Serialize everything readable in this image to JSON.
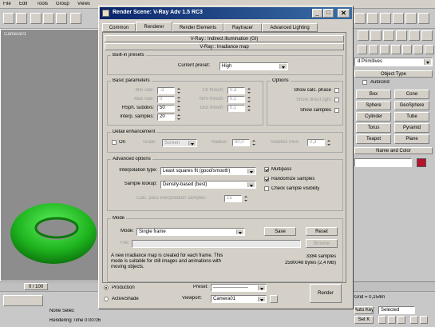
{
  "menubar": {
    "items": [
      "File",
      "Edit",
      "Tools",
      "Group",
      "Views"
    ]
  },
  "viewport": {
    "label": "Camera01"
  },
  "timeline": {
    "frame": "0 / 100"
  },
  "status": {
    "rendering_time": "Rendering Time  0:00:06",
    "none_selected": "None Selec",
    "auto_key": "Auto Key",
    "set_key": "Set K",
    "selected": "Selected",
    "add_time_tag": "Add Time Tag",
    "grid": "Grid = 0,254m"
  },
  "right_panel": {
    "dropdown": "d Primitives",
    "object_type_header": "Object Type",
    "autogrid": "AutoGrid",
    "buttons": [
      "Box",
      "Cone",
      "Sphere",
      "GeoSphere",
      "Cylinder",
      "Tube",
      "Torus",
      "Pyramid",
      "Teapot",
      "Plane"
    ],
    "name_color_header": "Name and Color",
    "color": "#b5122d"
  },
  "dialog": {
    "title": "Render Scene: V-Ray Adv 1.5 RC3",
    "tabs": [
      "Common",
      "Renderer",
      "Render Elements",
      "Raytracer",
      "Advanced Lighting"
    ],
    "rollout_gi": "V-Ray:: Indirect illumination (GI)",
    "rollout_irr": "V-Ray:: Irradiance map",
    "built_in_presets": {
      "title": "Built-in presets",
      "label": "Current preset:",
      "value": "High"
    },
    "basic_params": {
      "title": "Basic parameters",
      "min_rate": {
        "label": "Min rate:",
        "value": "-3"
      },
      "max_rate": {
        "label": "Max rate:",
        "value": "0"
      },
      "hsph": {
        "label": "HSph. subdivs:",
        "value": "50"
      },
      "interp": {
        "label": "Interp. samples:",
        "value": "20"
      },
      "clr_thresh": {
        "label": "Clr thresh:",
        "value": "0,3"
      },
      "nrm_thresh": {
        "label": "Nrm thresh:",
        "value": "0,1"
      },
      "dist_thresh": {
        "label": "Dist thresh:",
        "value": "0,1"
      }
    },
    "options": {
      "title": "Options",
      "show_calc": "Show calc. phase",
      "show_direct": "Show direct light",
      "show_samples": "Show samples"
    },
    "detail": {
      "title": "Detail enhancement",
      "on": "On",
      "scale": "Scale:",
      "scale_value": "Screen",
      "radius": "Radius:",
      "radius_value": "60,0",
      "subdivs_mult": "Subdivs mult.",
      "subdivs_value": "0,3"
    },
    "advanced": {
      "title": "Advanced options",
      "interp_type_label": "Interpolation type:",
      "interp_type_value": "Least squares fit (good/smooth)",
      "sample_lookup_label": "Sample lookup:",
      "sample_lookup_value": "Density-based (best)",
      "calc_pass_label": "Calc. pass interpolation samples:",
      "calc_pass_value": "15",
      "multipass": "Multipass",
      "randomize": "Randomize samples",
      "check_vis": "Check sample visibility"
    },
    "mode": {
      "title": "Mode",
      "mode_label": "Mode:",
      "mode_value": "Single frame",
      "save": "Save",
      "reset": "Reset",
      "file_label": "File:",
      "browse": "Browse",
      "info_text": "A new irradiance map is created for each frame. This mode is suitable for still images and animations with moving objects.",
      "samples": "3384 samples",
      "bytes": "2580048 bytes (2,4 MB)"
    },
    "bottom": {
      "production": "Production",
      "activeshade": "ActiveShade",
      "preset_label": "Preset:",
      "preset_value": "----------------------",
      "viewport_label": "Viewport:",
      "viewport_value": "Camera01",
      "render": "Render"
    }
  }
}
